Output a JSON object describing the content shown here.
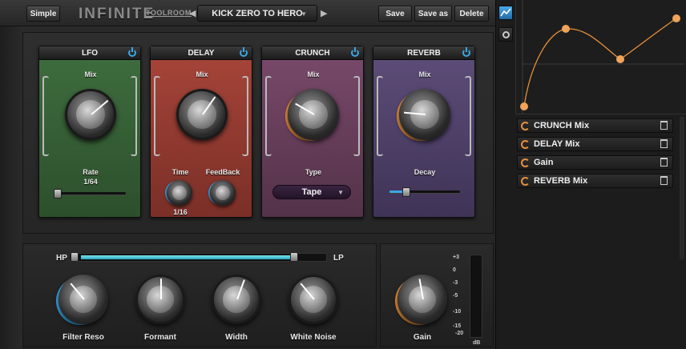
{
  "topbar": {
    "mode_button": "Simple",
    "logo": "INFINITE",
    "brand": "TOOLROOM",
    "preset_name": "KICK ZERO TO HERO",
    "prev_arrow": "◀",
    "next_arrow": "▶",
    "save": "Save",
    "save_as": "Save as",
    "delete": "Delete"
  },
  "modules": {
    "lfo": {
      "title": "LFO",
      "mix_label": "Mix",
      "rate_label": "Rate",
      "rate_value": "1/64",
      "color": "#3d6a3d"
    },
    "delay": {
      "title": "DELAY",
      "mix_label": "Mix",
      "time_label": "Time",
      "feedback_label": "FeedBack",
      "time_value": "1/16",
      "color": "#9a3b32"
    },
    "crunch": {
      "title": "CRUNCH",
      "mix_label": "Mix",
      "type_label": "Type",
      "type_value": "Tape",
      "color": "#6a3f5e"
    },
    "reverb": {
      "title": "REVERB",
      "mix_label": "Mix",
      "decay_label": "Decay",
      "color": "#5a4a72"
    }
  },
  "filter": {
    "hp_label": "HP",
    "lp_label": "LP",
    "knobs": [
      "Filter Reso",
      "Formant",
      "Width",
      "White Noise"
    ]
  },
  "gain": {
    "label": "Gain",
    "scale": [
      "+3",
      "0",
      "-3",
      "-5",
      "-10",
      "-15",
      "-20",
      "dB"
    ]
  },
  "mod_list": [
    {
      "label": "CRUNCH Mix"
    },
    {
      "label": "DELAY Mix"
    },
    {
      "label": "Gain"
    },
    {
      "label": "REVERB Mix"
    }
  ],
  "colors": {
    "accent_blue": "#3ba7e6",
    "accent_orange": "#e8913b"
  }
}
